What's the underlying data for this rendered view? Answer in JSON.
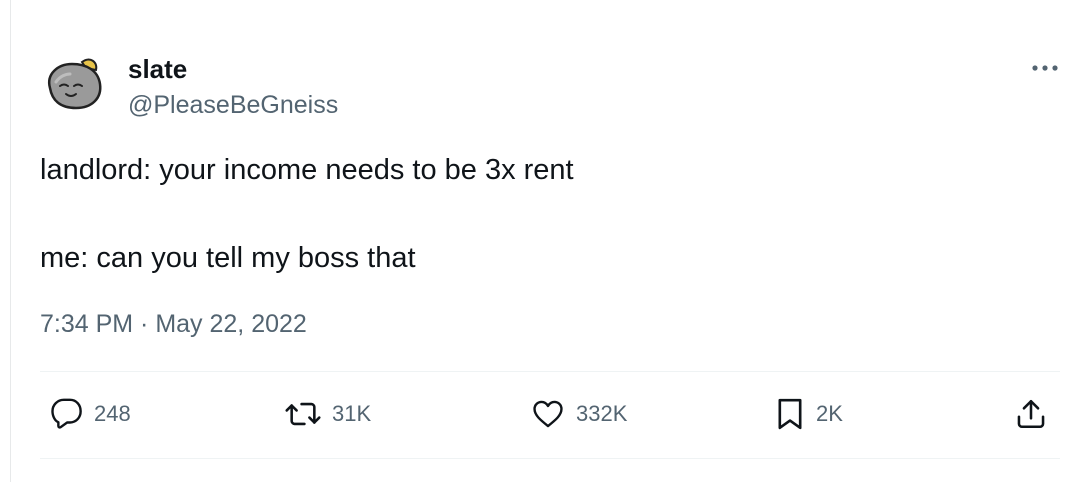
{
  "user": {
    "display_name": "slate",
    "handle": "@PleaseBeGneiss"
  },
  "tweet": {
    "lines": [
      "landlord: your income needs to be 3x rent",
      "me: can you tell my boss that"
    ],
    "timestamp": "7:34 PM · May 22, 2022"
  },
  "actions": {
    "replies": "248",
    "retweets": "31K",
    "likes": "332K",
    "bookmarks": "2K"
  },
  "icons": {
    "reply": "speech-bubble-icon",
    "retweet": "retweet-arrows-icon",
    "like": "heart-icon",
    "bookmark": "bookmark-icon",
    "share": "share-upload-icon",
    "more": "more-dots-icon"
  },
  "colors": {
    "text_primary": "#0f1419",
    "text_secondary": "#536471",
    "divider": "#eff3f4"
  }
}
